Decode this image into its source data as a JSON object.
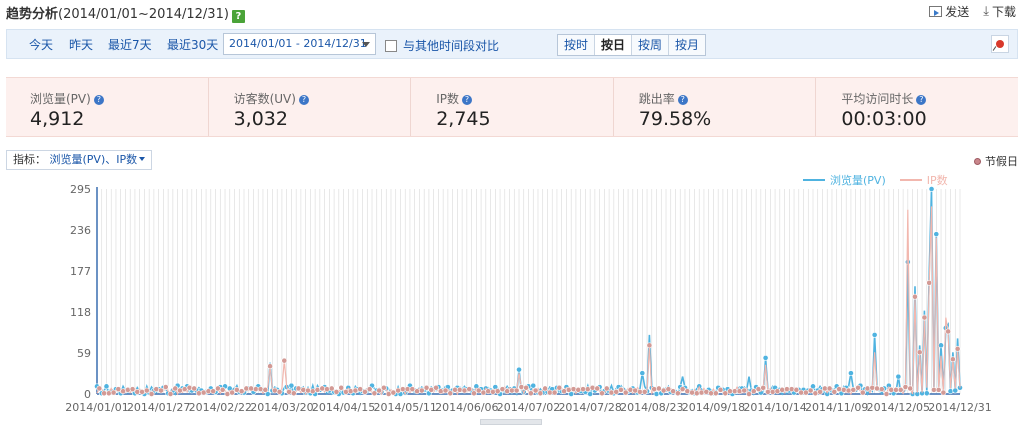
{
  "header": {
    "title_bold": "趋势分析",
    "title_range": "(2014/01/01~2014/12/31)",
    "help_icon": "question-icon",
    "send_label": "发送",
    "download_label": "下载"
  },
  "toolbar": {
    "quick_ranges": [
      "今天",
      "昨天",
      "最近7天",
      "最近30天"
    ],
    "date_range": "2014/01/01 - 2014/12/31",
    "compare_label": "与其他时间段对比",
    "compare_checked": false,
    "granularity": [
      "按时",
      "按日",
      "按周",
      "按月"
    ],
    "granularity_selected": "按日"
  },
  "summary": [
    {
      "label": "浏览量(PV)",
      "value": "4,912"
    },
    {
      "label": "访客数(UV)",
      "value": "3,032"
    },
    {
      "label": "IP数",
      "value": "2,745"
    },
    {
      "label": "跳出率",
      "value": "79.58%"
    },
    {
      "label": "平均访问时长",
      "value": "00:03:00"
    }
  ],
  "indicator": {
    "label": "指标：",
    "value": "浏览量(PV)、IP数"
  },
  "holiday_label": "节假日",
  "colors": {
    "pv": "#4fb3e0",
    "ip": "#f2b7ae",
    "pv_marker": "#4fb3e0",
    "ip_marker": "#d39a95"
  },
  "chart_data": {
    "type": "line",
    "ylim": [
      0,
      295
    ],
    "y_ticks": [
      0,
      59,
      118,
      177,
      236,
      295
    ],
    "x_tick_labels": [
      "2014/01/01",
      "2014/01/27",
      "2014/02/22",
      "2014/03/20",
      "2014/04/15",
      "2014/05/11",
      "2014/06/06",
      "2014/07/02",
      "2014/07/28",
      "2014/08/23",
      "2014/09/18",
      "2014/10/14",
      "2014/11/09",
      "2014/12/05",
      "2014/12/31"
    ],
    "x_tick_day_index": [
      0,
      26,
      52,
      78,
      104,
      130,
      156,
      182,
      208,
      234,
      260,
      286,
      312,
      338,
      364
    ],
    "days": 365,
    "legend": [
      "浏览量(PV)",
      "IP数"
    ],
    "grid": true,
    "series": [
      {
        "name": "浏览量(PV)",
        "peaks": [
          [
            73,
            45
          ],
          [
            178,
            35
          ],
          [
            230,
            30
          ],
          [
            233,
            85
          ],
          [
            247,
            25
          ],
          [
            275,
            25
          ],
          [
            282,
            52
          ],
          [
            318,
            30
          ],
          [
            328,
            85
          ],
          [
            338,
            25
          ],
          [
            342,
            190
          ],
          [
            345,
            155
          ],
          [
            347,
            70
          ],
          [
            349,
            120
          ],
          [
            351,
            175
          ],
          [
            352,
            295
          ],
          [
            354,
            230
          ],
          [
            356,
            70
          ],
          [
            358,
            95
          ],
          [
            359,
            100
          ],
          [
            361,
            60
          ],
          [
            363,
            80
          ]
        ]
      },
      {
        "name": "IP数",
        "peaks": [
          [
            73,
            40
          ],
          [
            79,
            48
          ],
          [
            178,
            30
          ],
          [
            233,
            70
          ],
          [
            282,
            42
          ],
          [
            328,
            60
          ],
          [
            342,
            265
          ],
          [
            345,
            140
          ],
          [
            347,
            60
          ],
          [
            349,
            110
          ],
          [
            351,
            160
          ],
          [
            352,
            270
          ],
          [
            354,
            225
          ],
          [
            356,
            55
          ],
          [
            358,
            110
          ],
          [
            359,
            90
          ],
          [
            361,
            50
          ],
          [
            363,
            65
          ]
        ]
      }
    ]
  }
}
